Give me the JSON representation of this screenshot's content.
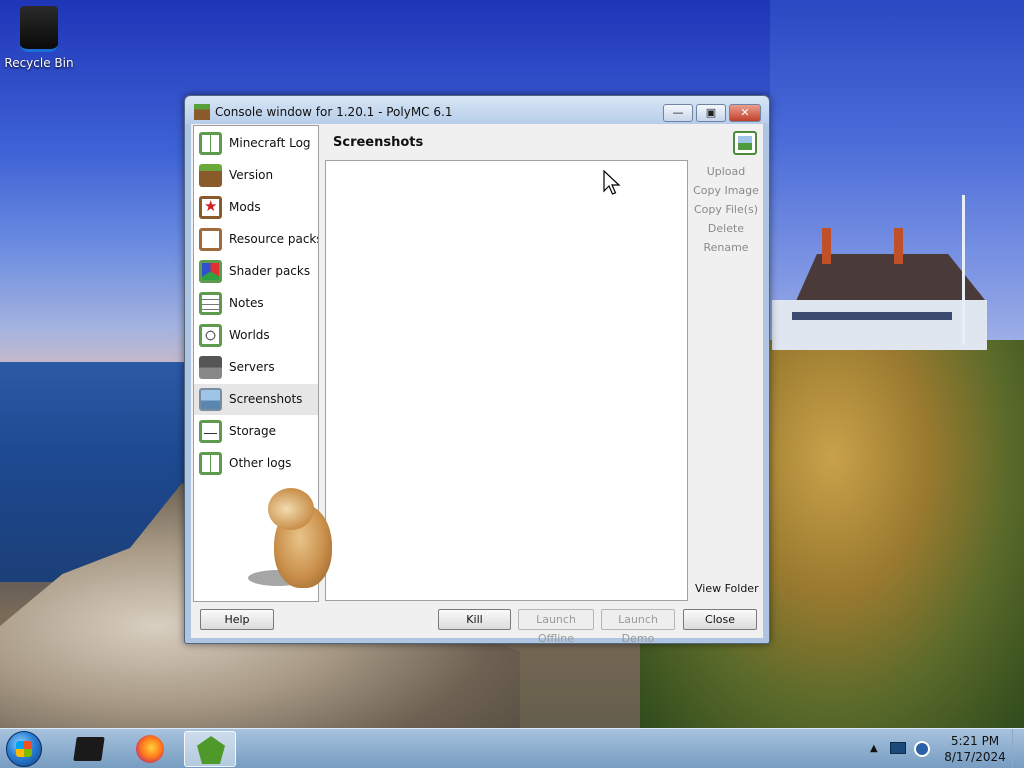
{
  "desktop": {
    "recycle_bin_label": "Recycle Bin"
  },
  "window": {
    "title": "Console window for 1.20.1 - PolyMC 6.1",
    "sidebar": {
      "items": [
        {
          "label": "Minecraft Log",
          "icon": "book-icon"
        },
        {
          "label": "Version",
          "icon": "grass-block-icon"
        },
        {
          "label": "Mods",
          "icon": "star-icon"
        },
        {
          "label": "Resource packs",
          "icon": "briefcase-icon"
        },
        {
          "label": "Shader packs",
          "icon": "color-cube-icon"
        },
        {
          "label": "Notes",
          "icon": "notes-icon"
        },
        {
          "label": "Worlds",
          "icon": "globe-icon"
        },
        {
          "label": "Servers",
          "icon": "servers-icon"
        },
        {
          "label": "Screenshots",
          "icon": "picture-icon",
          "active": true
        },
        {
          "label": "Storage",
          "icon": "storage-icon"
        },
        {
          "label": "Other logs",
          "icon": "book-icon"
        }
      ]
    },
    "page": {
      "title": "Screenshots",
      "actions": [
        "Upload",
        "Copy Image",
        "Copy File(s)",
        "Delete",
        "Rename"
      ],
      "view_folder": "View Folder"
    },
    "buttons": {
      "help": "Help",
      "kill": "Kill",
      "launch_offline": "Launch Offline",
      "launch_demo": "Launch Demo",
      "close": "Close"
    }
  },
  "taskbar": {
    "clock_time": "5:21 PM",
    "clock_date": "8/17/2024",
    "tray_arrow": "▲"
  }
}
